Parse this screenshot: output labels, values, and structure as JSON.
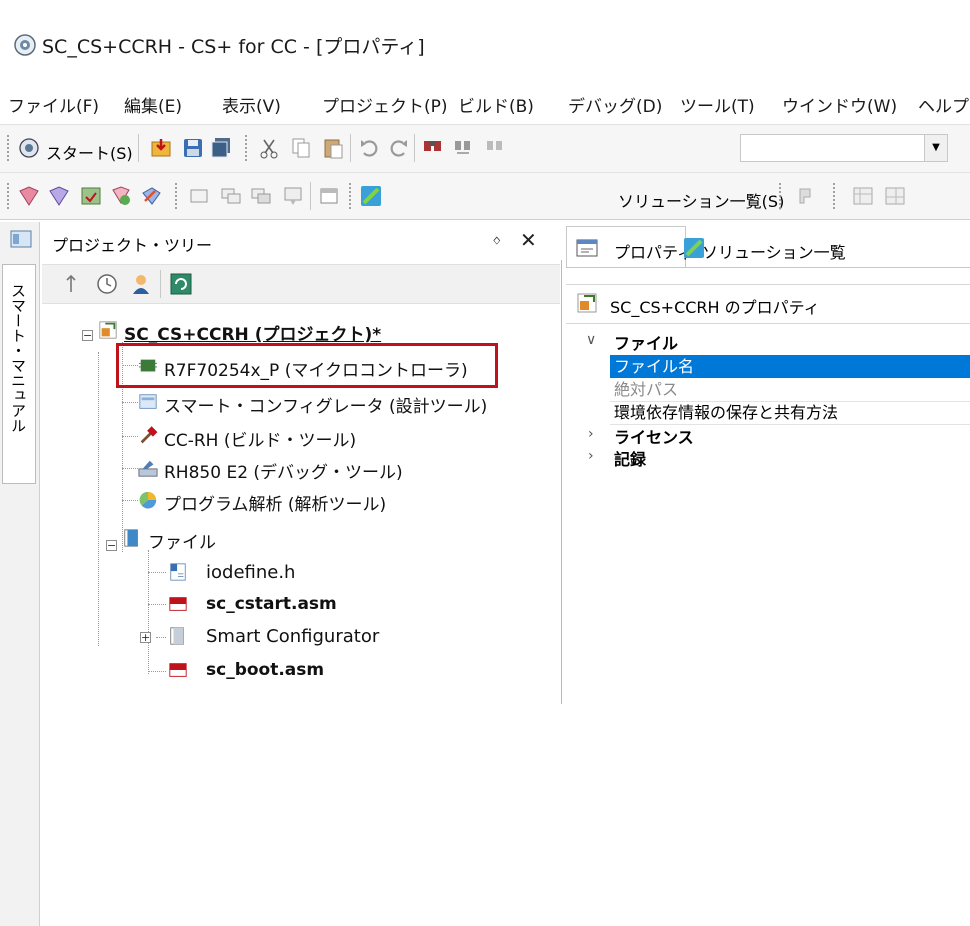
{
  "window": {
    "title": "SC_CS+CCRH - CS+ for CC - [プロパティ]"
  },
  "menu": {
    "items": [
      "ファイル(F)",
      "編集(E)",
      "表示(V)",
      "プロジェクト(P)",
      "ビルド(B)",
      "デバッグ(D)",
      "ツール(T)",
      "ウインドウ(W)",
      "ヘルプ("
    ]
  },
  "toolbar1": {
    "start_label": "スタート(S)"
  },
  "toolbar2": {
    "solution_list_label": "ソリューション一覧(S)"
  },
  "side_tab": {
    "label": "スマート・マニュアル"
  },
  "tree_panel": {
    "title": "プロジェクト・ツリー",
    "pin_glyph": "ᛜ",
    "close_glyph": "✕",
    "root": "SC_CS+CCRH (プロジェクト)*",
    "items": [
      "R7F70254x_P (マイクロコントローラ)",
      "スマート・コンフィグレータ (設計ツール)",
      "CC-RH (ビルド・ツール)",
      "RH850 E2 (デバッグ・ツール)",
      "プログラム解析 (解析ツール)"
    ],
    "folder": "ファイル",
    "files": [
      "iodefine.h",
      "sc_cstart.asm",
      "Smart Configurator",
      "sc_boot.asm"
    ]
  },
  "props_panel": {
    "tab_properties": "プロパティ",
    "tab_solution": "ソリューション一覧",
    "subtitle": "SC_CS+CCRH のプロパティ",
    "categories": [
      {
        "label": "ファイル",
        "expanded": true,
        "rows": [
          "ファイル名",
          "絶対パス",
          "環境依存情報の保存と共有方法"
        ]
      },
      {
        "label": "ライセンス",
        "expanded": false
      },
      {
        "label": "記録",
        "expanded": false
      }
    ]
  },
  "colors": {
    "highlight_border": "#c0121b",
    "selection": "#0078d7"
  }
}
